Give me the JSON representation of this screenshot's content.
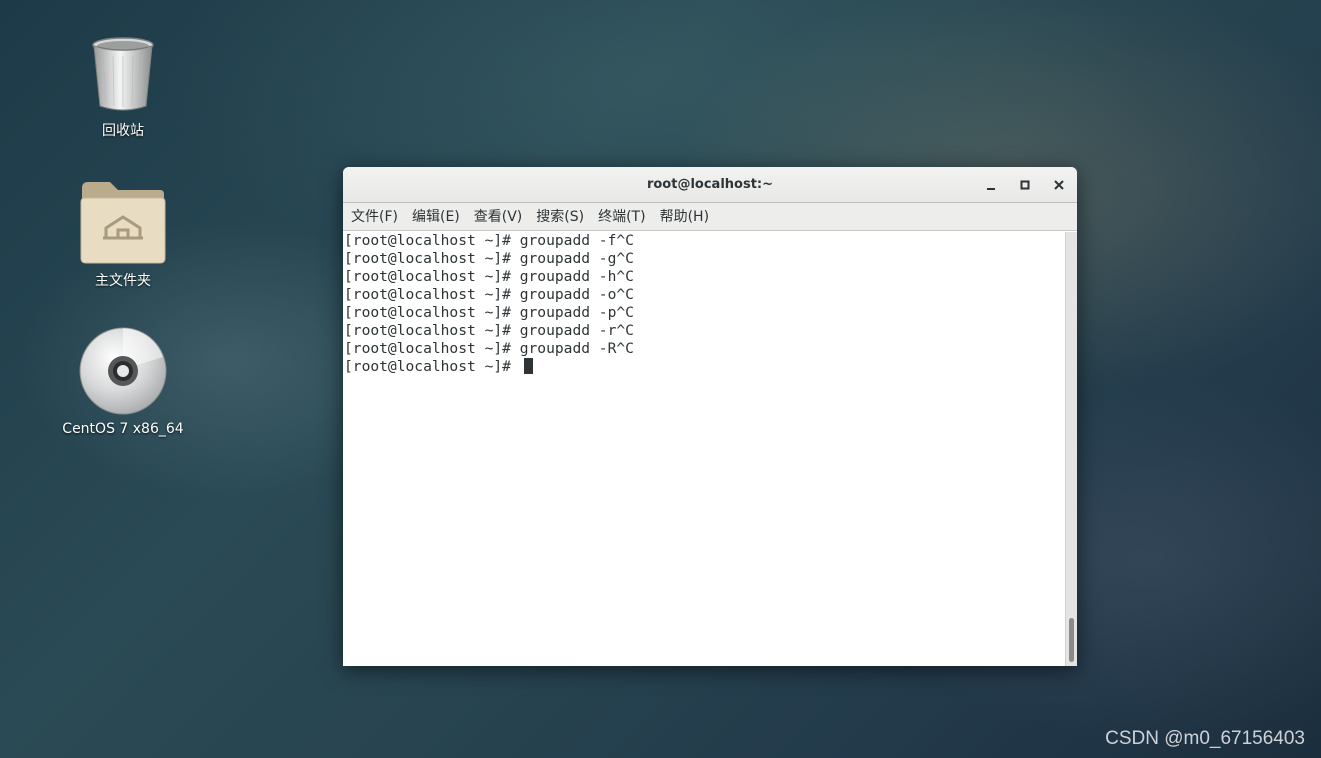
{
  "desktop": {
    "icons": [
      {
        "label": "回收站",
        "icon": "trash-icon"
      },
      {
        "label": "主文件夹",
        "icon": "home-folder-icon"
      },
      {
        "label": "CentOS 7 x86_64",
        "icon": "disc-icon"
      }
    ]
  },
  "window": {
    "title": "root@localhost:~",
    "controls": {
      "minimize": "–",
      "maximize": "□",
      "close": "✕"
    },
    "menu": [
      "文件(F)",
      "编辑(E)",
      "查看(V)",
      "搜索(S)",
      "终端(T)",
      "帮助(H)"
    ]
  },
  "terminal": {
    "lines": [
      "[root@localhost ~]# groupadd -f^C",
      "[root@localhost ~]# groupadd -g^C",
      "[root@localhost ~]# groupadd -h^C",
      "[root@localhost ~]# groupadd -o^C",
      "[root@localhost ~]# groupadd -p^C",
      "[root@localhost ~]# groupadd -r^C",
      "[root@localhost ~]# groupadd -R^C"
    ],
    "prompt": "[root@localhost ~]# "
  },
  "watermark": "CSDN @m0_67156403",
  "colors": {
    "terminal_text": "#2e3436",
    "terminal_bg": "#ffffff"
  }
}
